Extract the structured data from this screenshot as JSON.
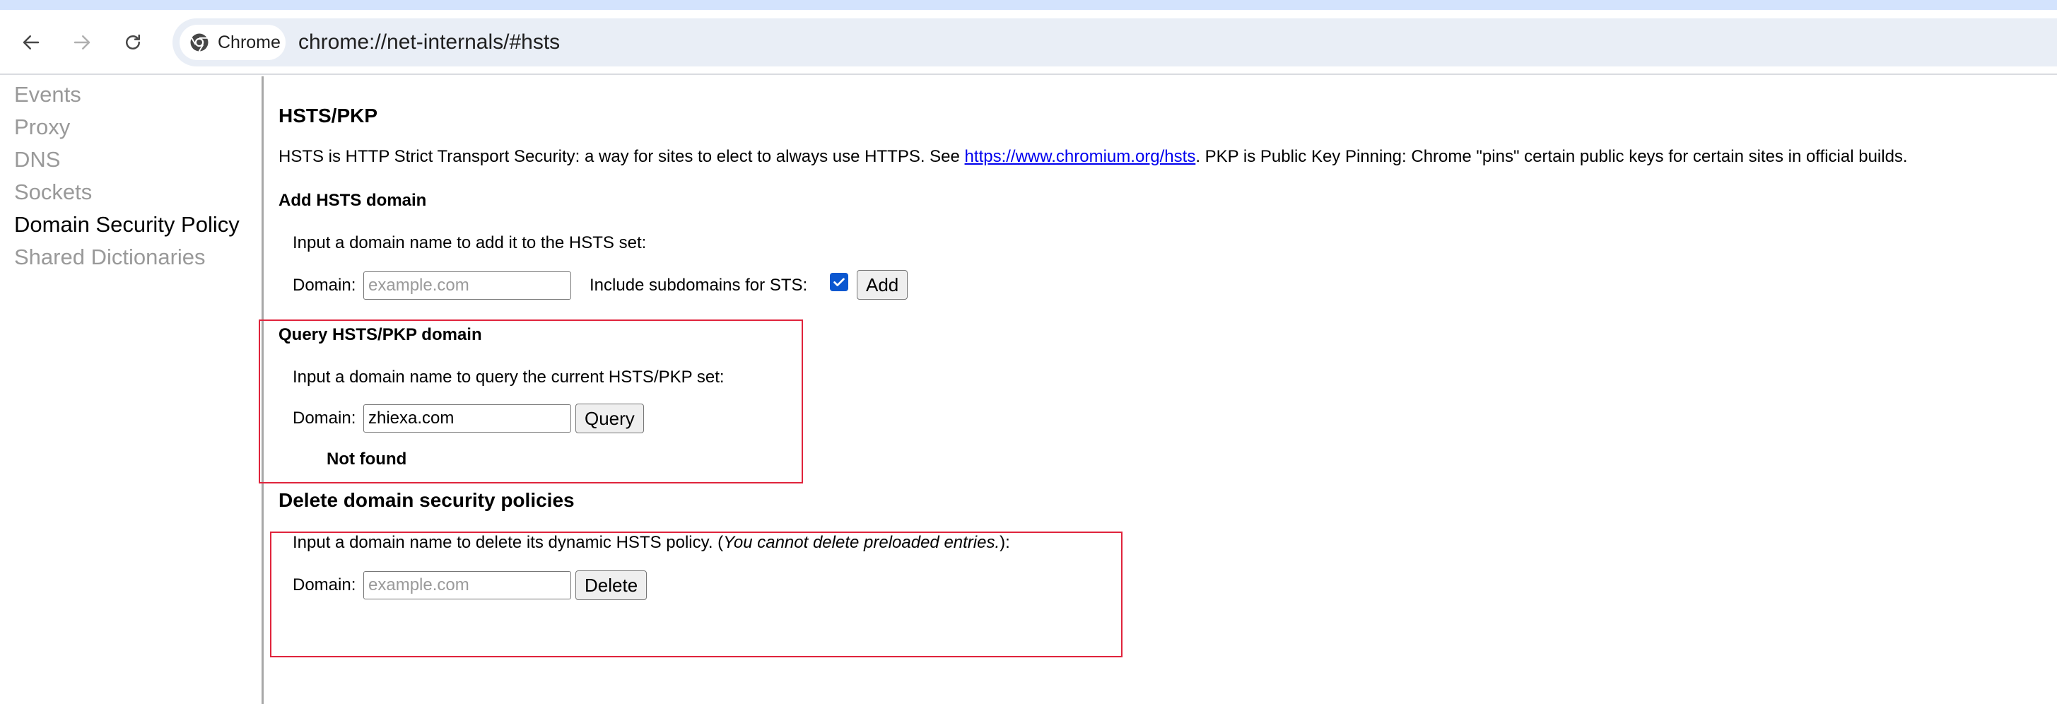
{
  "browser": {
    "chip_label": "Chrome",
    "url": "chrome://net-internals/#hsts",
    "icons": {
      "back": "back-arrow-icon",
      "forward": "forward-arrow-icon",
      "reload": "reload-icon",
      "chip": "chrome-logo-icon"
    }
  },
  "sidebar": {
    "items": [
      {
        "label": "Events",
        "active": false
      },
      {
        "label": "Proxy",
        "active": false
      },
      {
        "label": "DNS",
        "active": false
      },
      {
        "label": "Sockets",
        "active": false
      },
      {
        "label": "Domain Security Policy",
        "active": true
      },
      {
        "label": "Shared Dictionaries",
        "active": false
      }
    ]
  },
  "main": {
    "title": "HSTS/PKP",
    "description": {
      "before_link": "HSTS is HTTP Strict Transport Security: a way for sites to elect to always use HTTPS. See ",
      "link": "https://www.chromium.org/hsts",
      "after_link": ". PKP is Public Key Pinning: Chrome \"pins\" certain public keys for certain sites in official builds."
    },
    "add": {
      "heading": "Add HSTS domain",
      "instruction": "Input a domain name to add it to the HSTS set:",
      "domain_label": "Domain:",
      "placeholder": "example.com",
      "value": "",
      "subdomains_label": "Include subdomains for STS:",
      "subdomains_checked": true,
      "button": "Add"
    },
    "query": {
      "heading": "Query HSTS/PKP domain",
      "instruction": "Input a domain name to query the current HSTS/PKP set:",
      "domain_label": "Domain:",
      "value": "zhiexa.com",
      "button": "Query",
      "result": "Not found"
    },
    "delete": {
      "heading": "Delete domain security policies",
      "instruction_before": "Input a domain name to delete its dynamic HSTS policy. (",
      "instruction_italic": "You cannot delete preloaded entries.",
      "instruction_after": "):",
      "domain_label": "Domain:",
      "placeholder": "example.com",
      "value": "",
      "button": "Delete"
    }
  },
  "colors": {
    "highlight_box": "#e0243c",
    "omnibox_bg": "#e9eef6",
    "checkbox": "#0b57d0",
    "link": "#0000ee",
    "sidebar_inactive": "#999999"
  }
}
